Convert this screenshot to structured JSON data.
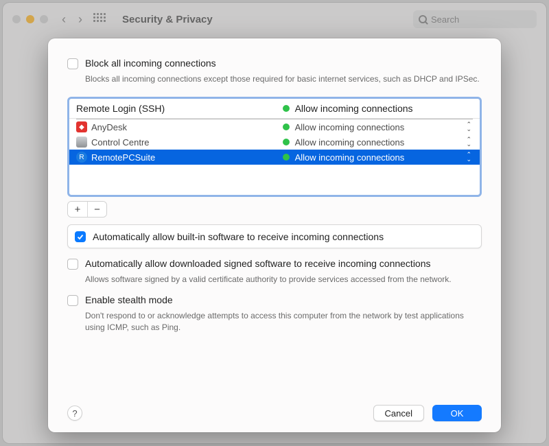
{
  "window": {
    "title": "Security & Privacy",
    "search_placeholder": "Search"
  },
  "options": {
    "block_all": {
      "checked": false,
      "label": "Block all incoming connections",
      "desc": "Blocks all incoming connections except those required for basic internet services, such as DHCP and IPSec."
    },
    "auto_builtin": {
      "checked": true,
      "label": "Automatically allow built-in software to receive incoming connections"
    },
    "auto_signed": {
      "checked": false,
      "label": "Automatically allow downloaded signed software to receive incoming connections",
      "desc": "Allows software signed by a valid certificate authority to provide services accessed from the network."
    },
    "stealth": {
      "checked": false,
      "label": "Enable stealth mode",
      "desc": "Don't respond to or acknowledge attempts to access this computer from the network by test applications using ICMP, such as Ping."
    }
  },
  "firewall_table": {
    "header": {
      "name": "Remote Login (SSH)",
      "status": "Allow incoming connections"
    },
    "rows": [
      {
        "icon": "anydesk-icon",
        "icon_color": "#e2332f",
        "name": "AnyDesk",
        "status": "Allow incoming connections",
        "selected": false
      },
      {
        "icon": "control-centre-icon",
        "icon_color": "#8f9295",
        "name": "Control Centre",
        "status": "Allow incoming connections",
        "selected": false
      },
      {
        "icon": "remotepc-icon",
        "icon_color": "#1a7be0",
        "name": "RemotePCSuite",
        "status": "Allow incoming connections",
        "selected": true
      }
    ]
  },
  "toolbar": {
    "add_label": "+",
    "remove_label": "−"
  },
  "footer": {
    "help_label": "?",
    "cancel_label": "Cancel",
    "ok_label": "OK"
  }
}
